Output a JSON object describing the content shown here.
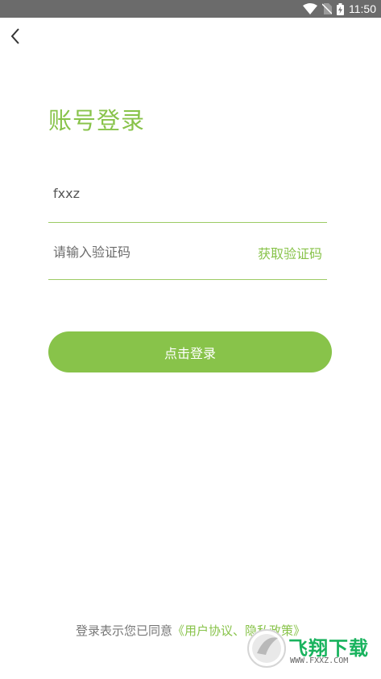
{
  "status_bar": {
    "time": "11:50"
  },
  "header": {
    "back_icon": "chevron-left-icon"
  },
  "page": {
    "title": "账号登录"
  },
  "form": {
    "account_value": "fxxz",
    "code_placeholder": "请输入验证码",
    "get_code_label": "获取验证码",
    "submit_label": "点击登录"
  },
  "agreement": {
    "prefix": "登录表示您已同意",
    "open_bracket": "《",
    "user_agreement": "用户协议",
    "separator": "、",
    "privacy_policy": "隐私政策",
    "close_bracket": "》"
  },
  "watermark": {
    "text": "飞翔下载",
    "url": "WWW.FXXZ.COM"
  },
  "colors": {
    "accent": "#88c34a",
    "status_bar": "#6b6b6b",
    "text_muted": "#777777"
  }
}
